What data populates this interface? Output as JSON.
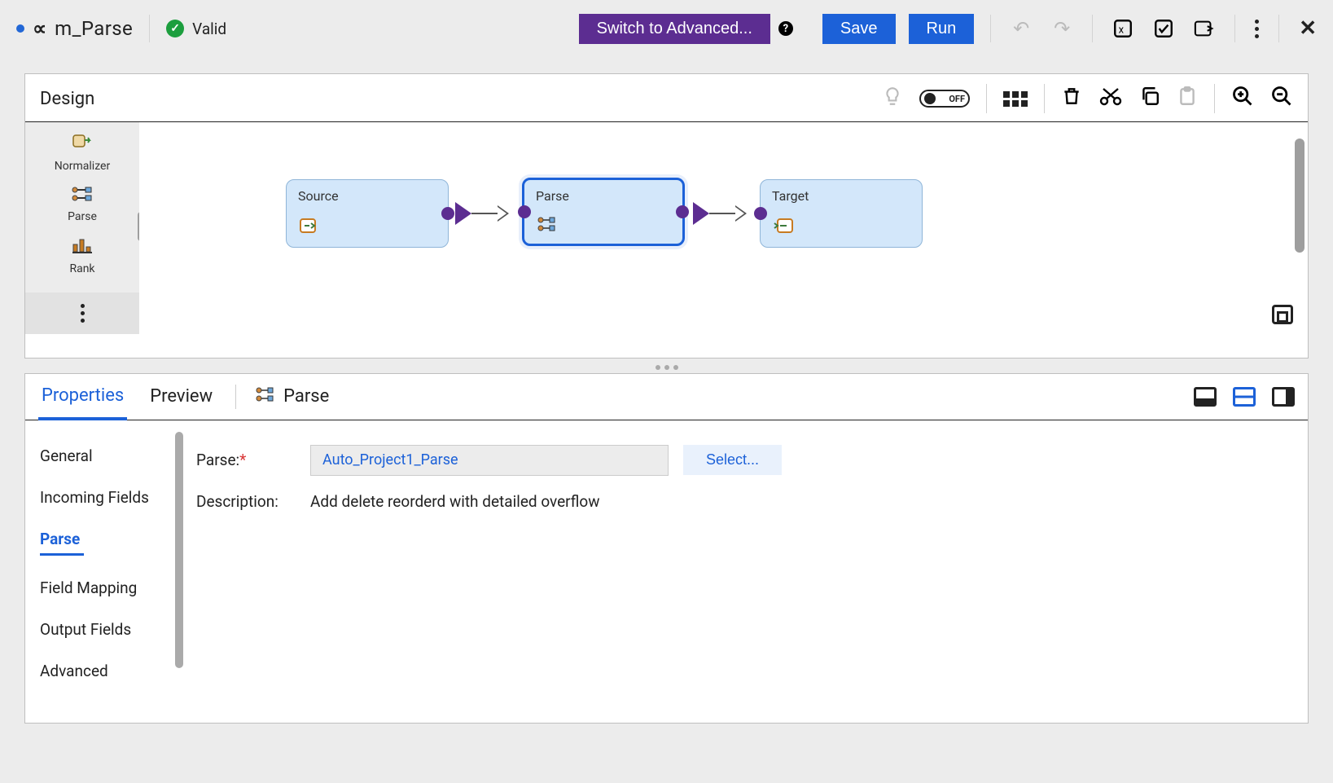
{
  "header": {
    "mapping_name": "m_Parse",
    "status_label": "Valid",
    "advanced_button": "Switch to Advanced...",
    "save_button": "Save",
    "run_button": "Run"
  },
  "design": {
    "title": "Design",
    "toggle_label": "OFF"
  },
  "palette": {
    "items": [
      {
        "label": "Normalizer",
        "icon": "↩"
      },
      {
        "label": "Parse",
        "icon": "⧉"
      },
      {
        "label": "Rank",
        "icon": "▮"
      }
    ]
  },
  "nodes": {
    "source": {
      "title": "Source"
    },
    "parse": {
      "title": "Parse"
    },
    "target": {
      "title": "Target"
    }
  },
  "props": {
    "tabs": {
      "properties": "Properties",
      "preview": "Preview",
      "subject": "Parse"
    },
    "side_tabs": {
      "general": "General",
      "incoming_fields": "Incoming Fields",
      "parse": "Parse",
      "field_mapping": "Field Mapping",
      "output_fields": "Output Fields",
      "advanced": "Advanced"
    },
    "form": {
      "parse_label": "Parse:",
      "parse_value": "Auto_Project1_Parse",
      "select_button": "Select...",
      "description_label": "Description:",
      "description_value": "Add delete reorderd with detailed overflow"
    }
  }
}
